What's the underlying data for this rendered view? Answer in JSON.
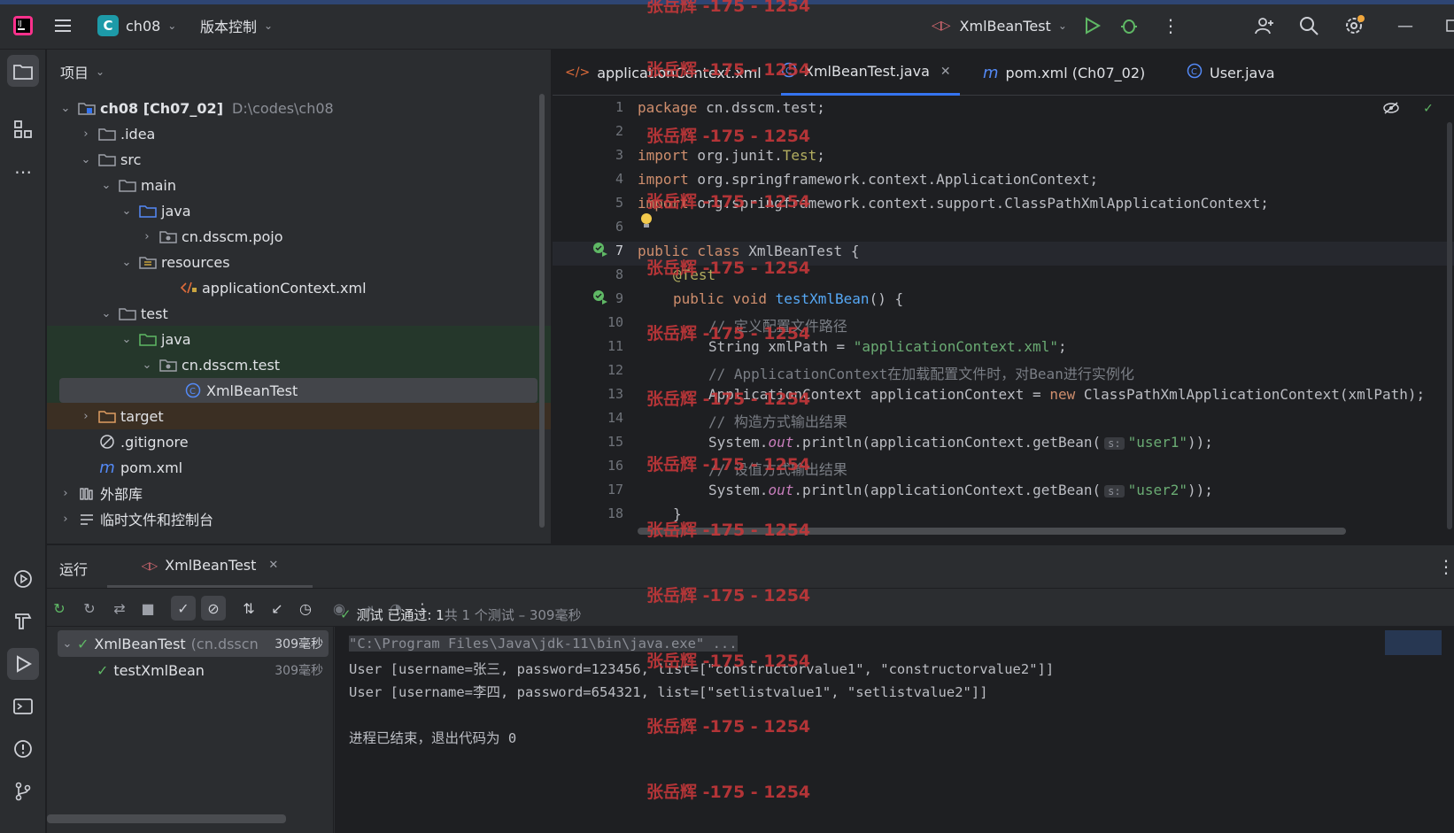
{
  "titlebar": {
    "project_badge": "C",
    "project_name": "ch08",
    "vcs_label": "版本控制",
    "run_config": "XmlBeanTest"
  },
  "project_panel": {
    "header": "项目",
    "tree": [
      {
        "label": "ch08 [Ch07_02]",
        "extra": "D:\\codes\\ch08",
        "icon": "module-folder-icon",
        "arrow": "down"
      },
      {
        "label": ".idea",
        "icon": "folder-icon",
        "arrow": "right"
      },
      {
        "label": "src",
        "icon": "folder-icon",
        "arrow": "down"
      },
      {
        "label": "main",
        "icon": "folder-icon",
        "arrow": "down"
      },
      {
        "label": "java",
        "icon": "source-folder-icon",
        "arrow": "down"
      },
      {
        "label": "cn.dsscm.pojo",
        "icon": "package-icon",
        "arrow": "right"
      },
      {
        "label": "resources",
        "icon": "resources-folder-icon",
        "arrow": "down"
      },
      {
        "label": "applicationContext.xml",
        "icon": "xml-file-icon",
        "arrow": ""
      },
      {
        "label": "test",
        "icon": "folder-icon",
        "arrow": "down"
      },
      {
        "label": "java",
        "icon": "test-folder-icon",
        "arrow": "down"
      },
      {
        "label": "cn.dsscm.test",
        "icon": "package-icon",
        "arrow": "down"
      },
      {
        "label": "XmlBeanTest",
        "icon": "class-icon",
        "arrow": ""
      },
      {
        "label": "target",
        "icon": "excluded-folder-icon",
        "arrow": "right"
      },
      {
        "label": ".gitignore",
        "icon": "ignore-file-icon",
        "arrow": ""
      },
      {
        "label": "pom.xml",
        "icon": "maven-icon",
        "arrow": ""
      },
      {
        "label": "外部库",
        "icon": "library-icon",
        "arrow": "right"
      },
      {
        "label": "临时文件和控制台",
        "icon": "scratch-icon",
        "arrow": "right"
      }
    ]
  },
  "editor_tabs": [
    {
      "label": "applicationContext.xml",
      "icon": "xml-file-icon"
    },
    {
      "label": "XmlBeanTest.java",
      "icon": "class-icon",
      "active": true
    },
    {
      "label": "pom.xml (Ch07_02)",
      "icon": "maven-icon"
    },
    {
      "label": "User.java",
      "icon": "class-icon"
    }
  ],
  "code_lines": [
    "1",
    "2",
    "3",
    "4",
    "5",
    "6",
    "7",
    "8",
    "9",
    "10",
    "11",
    "12",
    "13",
    "14",
    "15",
    "16",
    "17",
    "18"
  ],
  "code": {
    "l1_kw": "package",
    "l1_rest": " cn.dsscm.test;",
    "l3_kw": "import",
    "l3_a": " org.junit.",
    "l3_b": "Test",
    "l3_c": ";",
    "l4_kw": "import",
    "l4_rest": " org.springframework.context.ApplicationContext;",
    "l5_kw": "import",
    "l5_rest": " org.springframework.context.support.ClassPathXmlApplicationContext;",
    "l7_kw": "public class",
    "l7_rest": " XmlBeanTest {",
    "l8": "@Test",
    "l9_kw": "public void",
    "l9_fn": " testXmlBean",
    "l9_rest": "() {",
    "l10": "// 定义配置文件路径",
    "l11_a": "String xmlPath = ",
    "l11_str": "\"applicationContext.xml\"",
    "l11_c": ";",
    "l12": "// ApplicationContext在加载配置文件时，对Bean进行实例化",
    "l13_a": "ApplicationContext applicationContext = ",
    "l13_kw": "new",
    "l13_b": " ClassPathXmlApplicationContext(xmlPath);",
    "l14": "// 构造方式输出结果",
    "l15_a": "System.",
    "l15_out": "out",
    "l15_b": ".println(applicationContext.getBean(",
    "l15_hint": "s:",
    "l15_str": "\"user1\"",
    "l15_c": "));",
    "l16": "// 设值方式输出结果",
    "l17_a": "System.",
    "l17_out": "out",
    "l17_b": ".println(applicationContext.getBean(",
    "l17_hint": "s:",
    "l17_str": "\"user2\"",
    "l17_c": "));",
    "l18": "}"
  },
  "run_panel": {
    "title": "运行",
    "tab": "XmlBeanTest",
    "tests": [
      {
        "name": "XmlBeanTest",
        "extra": "(cn.dsscn",
        "time": "309毫秒"
      },
      {
        "name": "testXmlBean",
        "time": "309毫秒"
      }
    ],
    "status_pass": "测试 已通过: 1",
    "status_rest": "共 1 个测试 – 309毫秒",
    "console": [
      "\"C:\\Program Files\\Java\\jdk-11\\bin\\java.exe\" ...",
      "User [username=张三, password=123456, list=[\"constructorvalue1\", \"constructorvalue2\"]]",
      "User [username=李四, password=654321, list=[\"setlistvalue1\", \"setlistvalue2\"]]",
      "",
      "进程已结束，退出代码为 0"
    ]
  },
  "watermark": "张岳辉 -175 - 1254",
  "colors": {
    "accent": "#3574f0",
    "pass": "#5fb865",
    "watermark": "#c8383a"
  }
}
